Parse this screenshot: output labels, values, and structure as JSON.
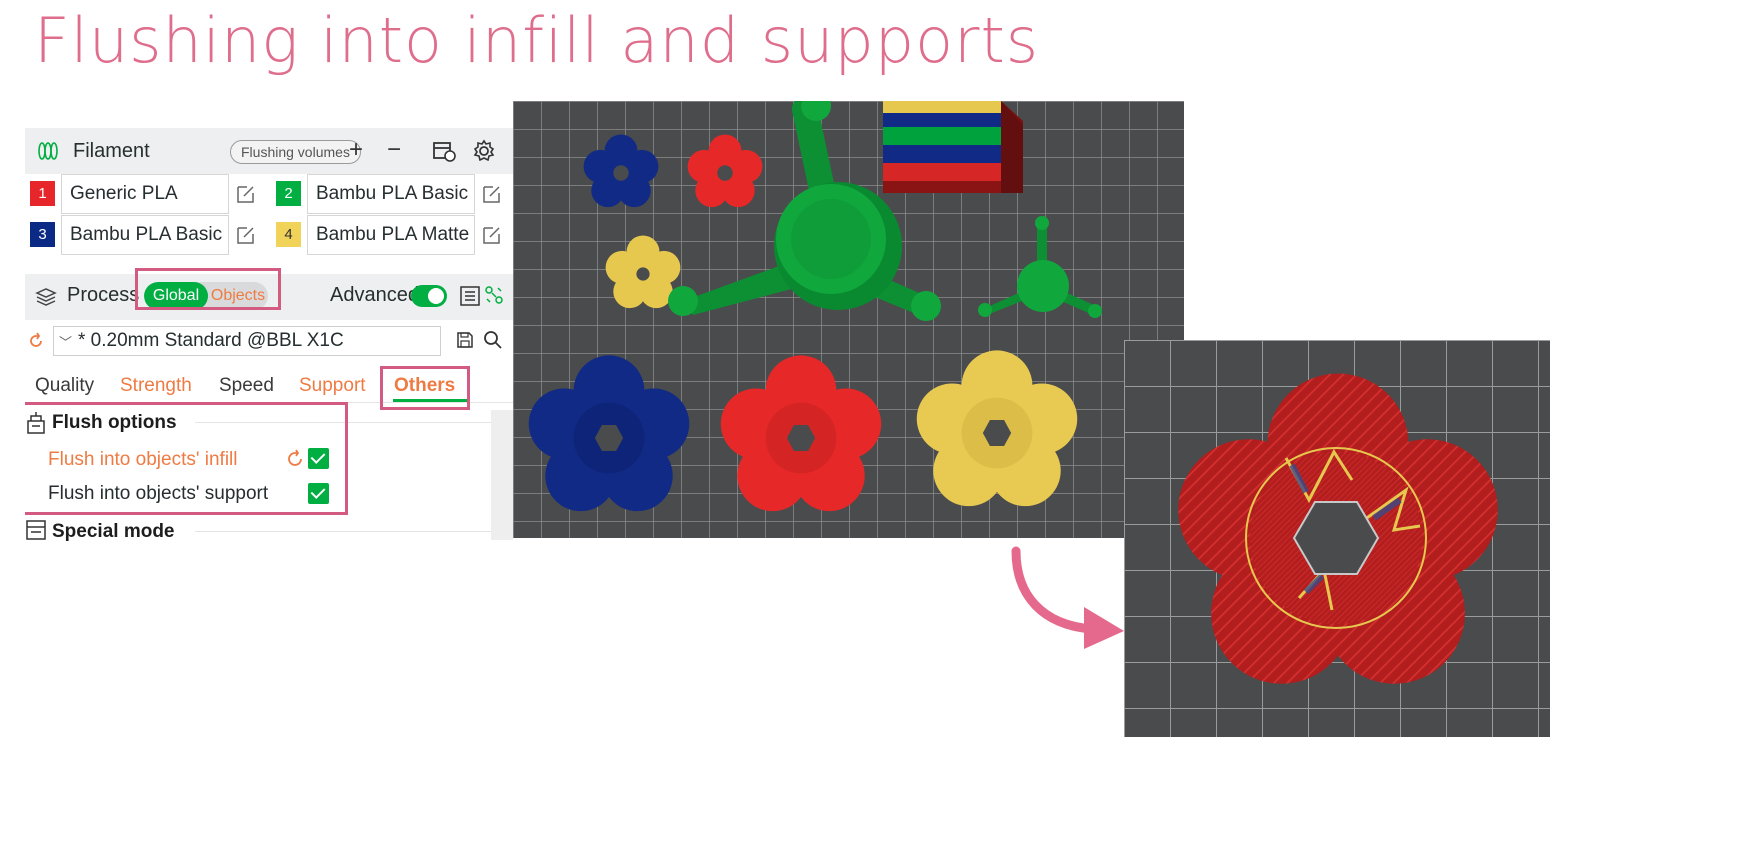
{
  "title": "Flushing into infill and supports",
  "filament": {
    "header": "Filament",
    "flushing_volumes": "Flushing volumes",
    "slots": [
      {
        "num": "1",
        "name": "Generic PLA",
        "color": "#e7262b",
        "num_color": "#ffffff"
      },
      {
        "num": "2",
        "name": "Bambu PLA Basic",
        "color": "#00ae42",
        "num_color": "#ffffff"
      },
      {
        "num": "3",
        "name": "Bambu PLA Basic",
        "color": "#0b2a85",
        "num_color": "#ffffff"
      },
      {
        "num": "4",
        "name": "Bambu PLA Matte",
        "color": "#f2d35a",
        "num_color": "#333333"
      }
    ]
  },
  "process": {
    "header": "Process",
    "global": "Global",
    "objects": "Objects",
    "advanced": "Advanced",
    "advanced_on": true,
    "preset": "* 0.20mm Standard @BBL X1C"
  },
  "tabs": [
    {
      "label": "Quality",
      "color": "#3a3a3a"
    },
    {
      "label": "Strength",
      "color": "#ef7b44"
    },
    {
      "label": "Speed",
      "color": "#3a3a3a"
    },
    {
      "label": "Support",
      "color": "#ef7b44"
    },
    {
      "label": "Others",
      "color": "#ef7b44",
      "active": true
    }
  ],
  "flush_options": {
    "title": "Flush options",
    "infill_label": "Flush into objects' infill",
    "infill_checked": true,
    "support_label": "Flush into objects' support",
    "support_checked": true
  },
  "special_mode": {
    "title": "Special mode"
  },
  "colors": {
    "title": "#df6d8c",
    "highlight": "#d35a80",
    "green": "#00ae42",
    "orange": "#ef7b44",
    "plate": "#4a4b4c"
  }
}
